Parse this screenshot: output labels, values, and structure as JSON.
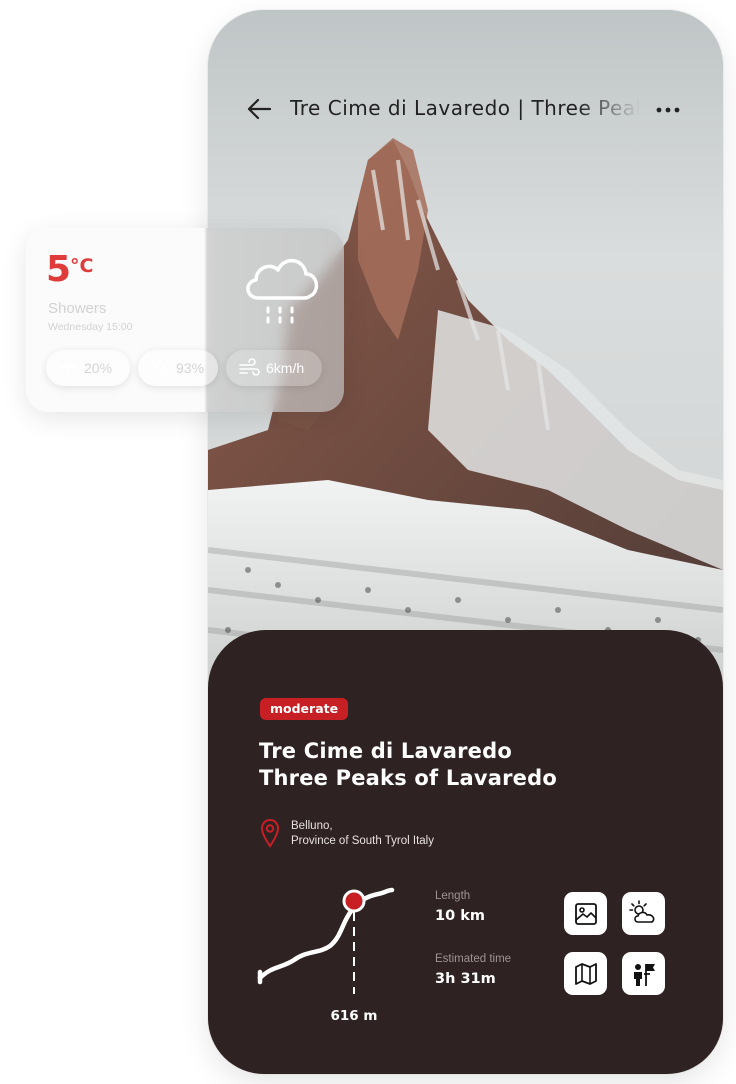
{
  "header": {
    "title": "Tre Cime di Lavaredo | Three Peaks of Lavaredo"
  },
  "weather": {
    "temperature": "5",
    "unit": "°C",
    "condition": "Showers",
    "time": "Wednesday 15:00",
    "precipitation": "20%",
    "humidity": "93%",
    "wind": "6km/h",
    "icons": [
      "rain-cloud-icon",
      "umbrella-icon",
      "humidity-icon",
      "wind-icon"
    ]
  },
  "trail": {
    "difficulty": "moderate",
    "title_line1": "Tre Cime di Lavaredo",
    "title_line2": "Three Peaks of Lavaredo",
    "location_line1": "Belluno,",
    "location_line2": "Province of South Tyrol Italy",
    "elevation": "616 m",
    "length_label": "Length",
    "length_value": "10 km",
    "time_label": "Estimated time",
    "time_value": "3h 31m"
  },
  "actions": [
    "gallery-icon",
    "weather-icon",
    "map-icon",
    "guide-icon"
  ],
  "colors": {
    "accent": "#c81f25",
    "sheet": "#2f2222",
    "temperature": "#e03b3b"
  }
}
